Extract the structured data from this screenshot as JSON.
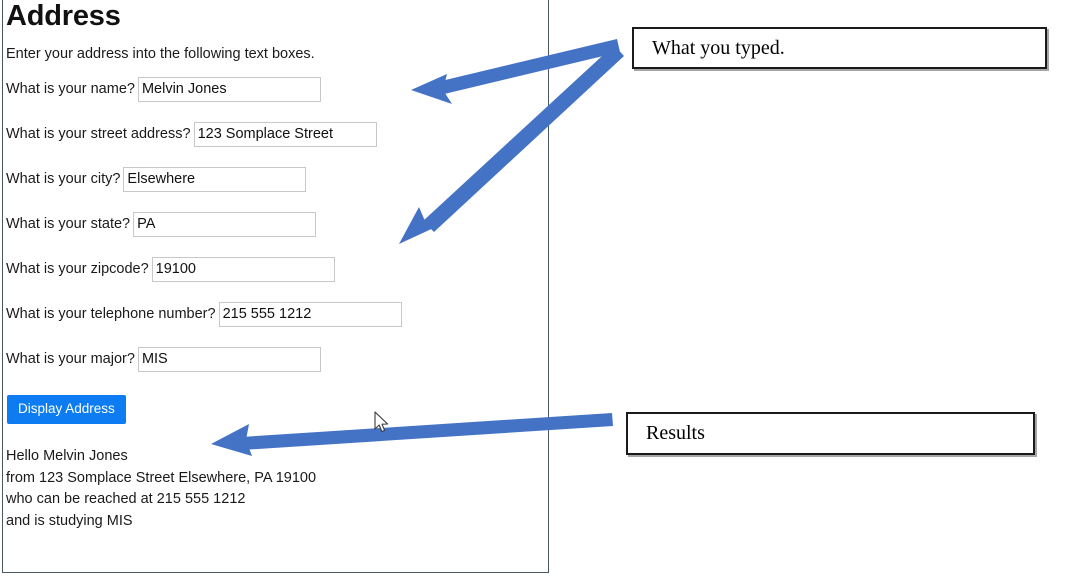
{
  "page": {
    "title": "Address",
    "intro": "Enter your address into the following text boxes."
  },
  "form": {
    "fields": [
      {
        "label": "What is your name?",
        "value": "Melvin Jones",
        "name": "name"
      },
      {
        "label": "What is your street address?",
        "value": "123 Somplace Street",
        "name": "street-address"
      },
      {
        "label": "What is your city?",
        "value": "Elsewhere",
        "name": "city"
      },
      {
        "label": "What is your state?",
        "value": "PA",
        "name": "state"
      },
      {
        "label": "What is your zipcode?",
        "value": "19100",
        "name": "zipcode"
      },
      {
        "label": "What is your telephone number?",
        "value": "215 555 1212",
        "name": "telephone"
      },
      {
        "label": "What is your major?",
        "value": "MIS",
        "name": "major"
      }
    ],
    "submit_label": "Display Address"
  },
  "results": {
    "line1": "Hello Melvin Jones",
    "line2": "from 123 Somplace Street Elsewhere, PA 19100",
    "line3": "who can be reached at 215 555 1212",
    "line4": "and is studying MIS"
  },
  "annotations": {
    "typed_label": "What you typed.",
    "results_label": "Results"
  },
  "colors": {
    "arrow_blue": "#4472C4",
    "button_blue": "#0d7cf2",
    "callout_border": "#1a1a1a",
    "panel_border": "#49575f",
    "input_border": "#c8c8c8"
  },
  "icons": {
    "mouse_cursor": "mouse-pointer-icon",
    "arrow_typed_top": "arrow-left-icon",
    "arrow_typed_bottom": "arrow-down-left-icon",
    "arrow_results": "arrow-left-icon"
  }
}
